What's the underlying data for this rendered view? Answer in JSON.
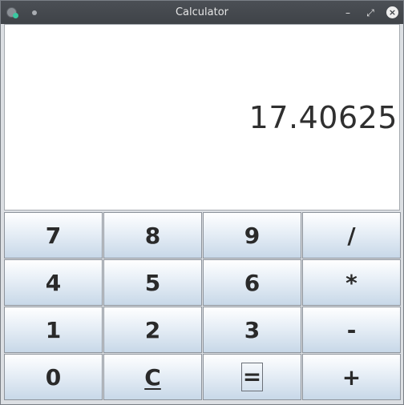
{
  "window": {
    "title": "Calculator",
    "controls": {
      "minimize": "–",
      "maximize": "⤢",
      "close": "×"
    }
  },
  "display": {
    "value": "17.40625"
  },
  "keypad": {
    "rows": [
      [
        "7",
        "8",
        "9",
        "/"
      ],
      [
        "4",
        "5",
        "6",
        "*"
      ],
      [
        "1",
        "2",
        "3",
        "-"
      ],
      [
        "0",
        "C",
        "=",
        "+"
      ]
    ]
  },
  "colors": {
    "titlebar": "#43474c",
    "button_top": "#ffffff",
    "button_bottom": "#c8d8e8",
    "display_bg": "#ffffff"
  }
}
